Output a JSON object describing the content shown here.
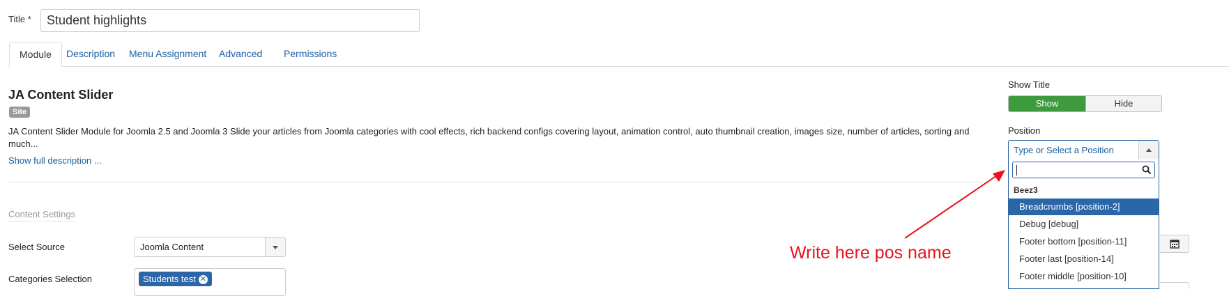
{
  "title_field": {
    "label": "Title *",
    "value": "Student highlights"
  },
  "tabs": [
    {
      "label": "Module",
      "active": true
    },
    {
      "label": "Description",
      "active": false
    },
    {
      "label": "Menu Assignment",
      "active": false
    },
    {
      "label": "Advanced",
      "active": false
    },
    {
      "label": "Permissions",
      "active": false
    }
  ],
  "module": {
    "name": "JA Content Slider",
    "badge": "Site",
    "description": "JA Content Slider Module for Joomla 2.5 and Joomla 3 Slide your articles from Joomla categories with cool effects, rich backend configs covering layout, animation control, auto thumbnail creation, images size, number of articles, sorting and much...",
    "show_full_link": "Show full description ..."
  },
  "content_settings": {
    "section_title": "Content Settings",
    "select_source": {
      "label": "Select Source",
      "value": "Joomla Content"
    },
    "categories": {
      "label": "Categories Selection",
      "chips": [
        "Students test"
      ]
    }
  },
  "show_title": {
    "label": "Show Title",
    "on": "Show",
    "off": "Hide",
    "selected": "Show"
  },
  "position": {
    "label": "Position",
    "placeholder": "Type or Select a Position",
    "search_value": "",
    "group": "Beez3",
    "options": [
      "Breadcrumbs [position-2]",
      "Debug [debug]",
      "Footer bottom [position-11]",
      "Footer last [position-14]",
      "Footer middle [position-10]"
    ],
    "highlighted_index": 0
  },
  "annotation": {
    "text": "Write here pos name",
    "color": "#e8131b"
  },
  "icons": [
    "search-icon",
    "calendar-icon",
    "remove-chip-icon",
    "chevron-down-icon",
    "chevron-up-icon"
  ]
}
